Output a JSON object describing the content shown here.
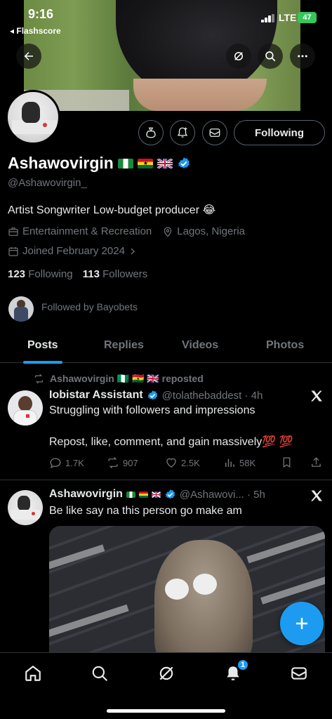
{
  "status_bar": {
    "time": "9:16",
    "back_app": "◂ Flashscore",
    "network": "LTE",
    "battery": "47"
  },
  "header_buttons": {
    "back": "back-arrow-icon",
    "grok": "grok-icon",
    "search": "search-icon",
    "more": "more-icon"
  },
  "profile": {
    "name": "Ashawovirgin",
    "handle": "@Ashawovirgin_",
    "bio": "Artist Songwriter Low-budget producer 😂",
    "category": "Entertainment & Recreation",
    "location": "Lagos, Nigeria",
    "joined": "Joined February 2024",
    "following_count": "123",
    "following_label": "Following",
    "followers_count": "113",
    "followers_label": "Followers",
    "followed_by": "Followed by Bayobets",
    "follow_button": "Following"
  },
  "tabs": [
    "Posts",
    "Replies",
    "Videos",
    "Photos"
  ],
  "posts": [
    {
      "repost_label": "Ashawovirgin 🇳🇬 🇬🇭 🇬🇧 reposted",
      "author": "Iobistar Assistant",
      "handle_time": "@tolathebaddest · 4h",
      "text_line1": "Struggling with followers and impressions",
      "text_line2": "Repost, like, comment, and gain massively💯 💯",
      "replies": "1.7K",
      "reposts": "907",
      "likes": "2.5K",
      "views": "58K"
    },
    {
      "author": "Ashawovirgin",
      "handle_time": "@Ashawovi... · 5h",
      "text_line1": "Be like say na this person go make am"
    }
  ],
  "bottom_nav": {
    "notifications_badge": "1"
  },
  "colors": {
    "accent": "#1d9bf0",
    "muted": "#71767b",
    "border": "#2f3336"
  }
}
